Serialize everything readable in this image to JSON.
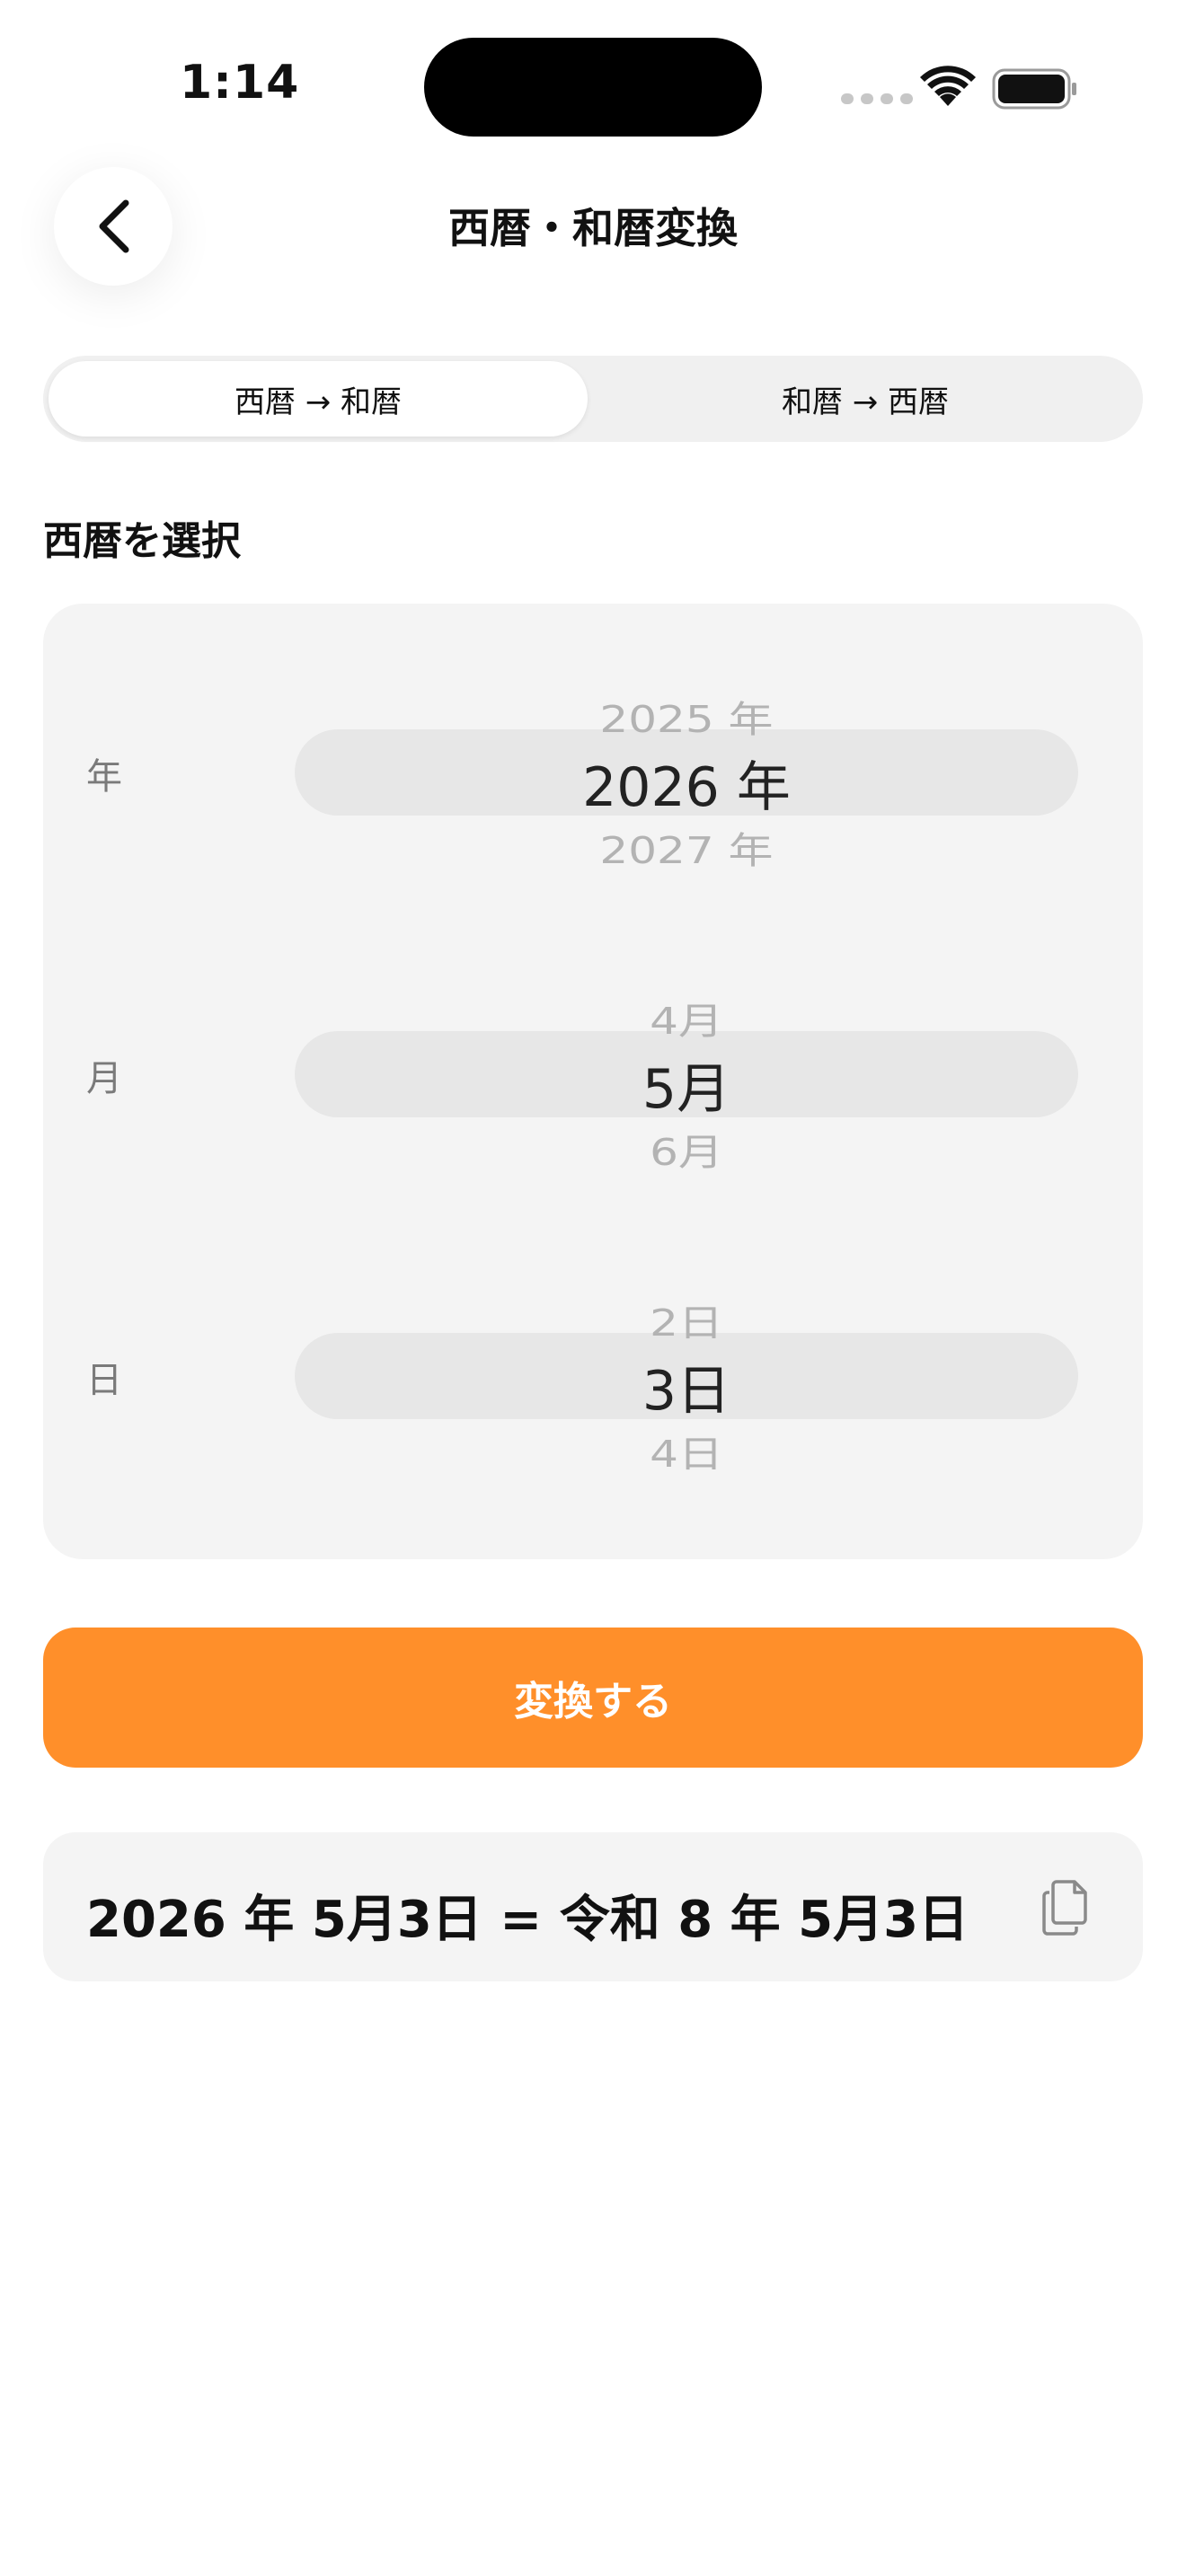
{
  "status_bar": {
    "time": "1:14"
  },
  "nav": {
    "title": "西暦・和暦変換"
  },
  "tabs": [
    {
      "label": "西暦 → 和暦",
      "active": true
    },
    {
      "label": "和暦 → 西暦",
      "active": false
    }
  ],
  "section_label": "西暦を選択",
  "picker": {
    "year": {
      "label": "年",
      "prev": "2025 年",
      "selected": "2026 年",
      "next": "2027 年"
    },
    "month": {
      "label": "月",
      "prev": "4月",
      "selected": "5月",
      "next": "6月"
    },
    "day": {
      "label": "日",
      "prev": "2日",
      "selected": "3日",
      "next": "4日"
    }
  },
  "convert_button_label": "変換する",
  "result": {
    "text": "2026 年 5月3日 = 令和 8 年 5月3日"
  },
  "colors": {
    "accent": "#ff8f2a",
    "card_background": "#f4f4f4"
  },
  "icons": {
    "back": "chevron-left-icon",
    "copy": "copy-icon",
    "wifi": "wifi-icon",
    "battery": "battery-icon"
  }
}
